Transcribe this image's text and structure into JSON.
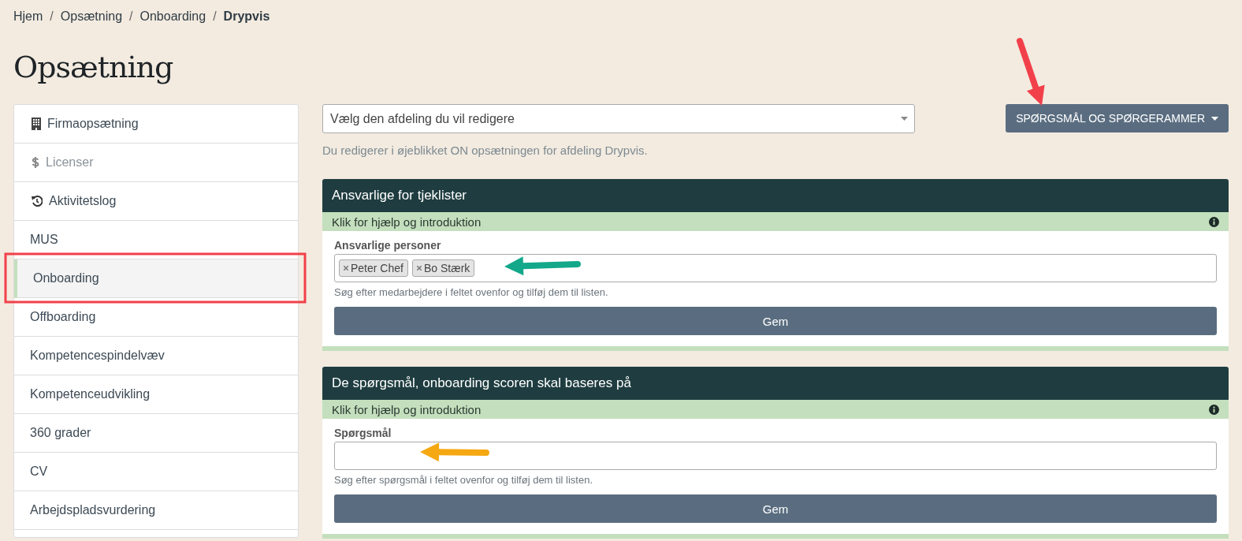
{
  "breadcrumb": [
    {
      "label": "Hjem",
      "current": false
    },
    {
      "label": "Opsætning",
      "current": false
    },
    {
      "label": "Onboarding",
      "current": false
    },
    {
      "label": "Drypvis",
      "current": true
    }
  ],
  "breadcrumb_separator": "/",
  "page_title": "Opsætning",
  "sidebar": {
    "items": [
      {
        "label": "Firmaopsætning",
        "kind": "building",
        "selected": false,
        "disabled": false
      },
      {
        "label": "Licenser",
        "kind": "dollar",
        "selected": false,
        "disabled": true
      },
      {
        "label": "Aktivitetslog",
        "kind": "history",
        "selected": false,
        "disabled": false
      },
      {
        "label": "MUS",
        "kind": "plain",
        "selected": false,
        "disabled": false
      },
      {
        "label": "Onboarding",
        "kind": "plain",
        "selected": true,
        "disabled": false
      },
      {
        "label": "Offboarding",
        "kind": "plain",
        "selected": false,
        "disabled": false
      },
      {
        "label": "Kompetencespindelvæv",
        "kind": "plain",
        "selected": false,
        "disabled": false
      },
      {
        "label": "Kompetenceudvikling",
        "kind": "plain",
        "selected": false,
        "disabled": false
      },
      {
        "label": "360 grader",
        "kind": "plain",
        "selected": false,
        "disabled": false
      },
      {
        "label": "CV",
        "kind": "plain",
        "selected": false,
        "disabled": false
      },
      {
        "label": "Arbejdspladsvurdering",
        "kind": "plain",
        "selected": false,
        "disabled": false
      }
    ]
  },
  "department_select": {
    "placeholder": "Vælg den afdeling du vil redigere"
  },
  "dropdown_button": {
    "label": "SPØRGSMÅL OG SPØRGERAMMER"
  },
  "info_text": "Du redigerer i øjeblikket ON opsætningen for afdeling Drypvis.",
  "cards": [
    {
      "title": "Ansvarlige for tjeklister",
      "help": "Klik for hjælp og introduktion",
      "field_label": "Ansvarlige personer",
      "tags": [
        "Peter Chef",
        "Bo Stærk"
      ],
      "hint": "Søg efter medarbejdere i feltet ovenfor og tilføj dem til listen.",
      "button": "Gem"
    },
    {
      "title": "De spørgsmål, onboarding scoren skal baseres på",
      "help": "Klik for hjælp og introduktion",
      "field_label": "Spørgsmål",
      "hint": "Søg efter spørgsmål i feltet ovenfor og tilføj dem til listen.",
      "button": "Gem"
    }
  ],
  "annotations": [
    {
      "kind": "arrow",
      "color": "#f2404a"
    },
    {
      "kind": "box",
      "color": "#f2404a"
    },
    {
      "kind": "arrow",
      "color": "#13a88a"
    },
    {
      "kind": "arrow",
      "color": "#f5a812"
    }
  ]
}
